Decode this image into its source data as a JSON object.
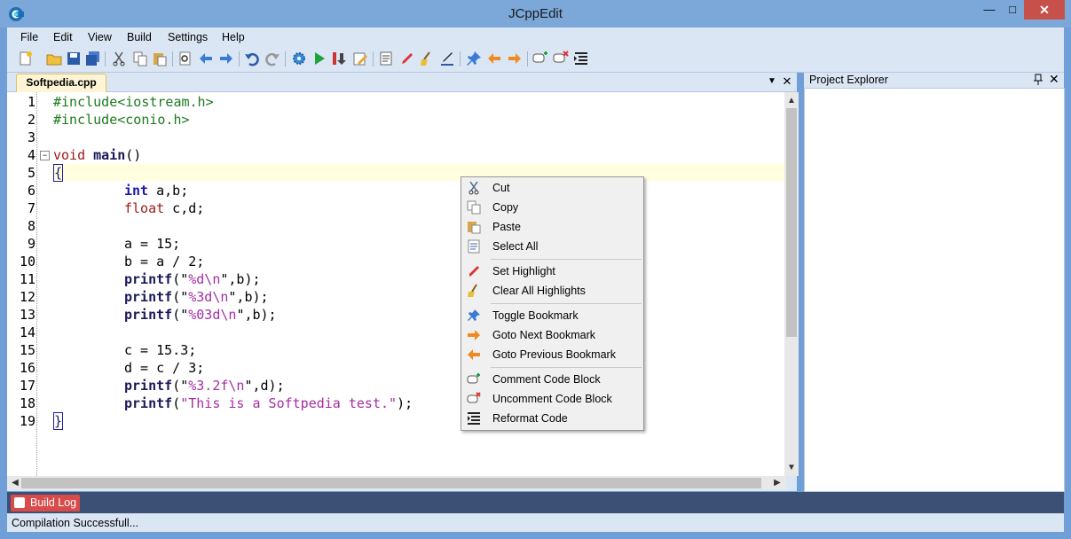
{
  "window": {
    "title": "JCppEdit",
    "min": "—",
    "max": "□",
    "close": "✕"
  },
  "menu": [
    "File",
    "Edit",
    "View",
    "Build",
    "Settings",
    "Help"
  ],
  "tab": {
    "label": "Softpedia.cpp",
    "dropdown": "▼",
    "close": "✕"
  },
  "line_numbers": [
    "1",
    "2",
    "3",
    "4",
    "5",
    "6",
    "7",
    "8",
    "9",
    "10",
    "11",
    "12",
    "13",
    "14",
    "15",
    "16",
    "17",
    "18",
    "19"
  ],
  "code": {
    "l1": "#include<iostream.h>",
    "l2": "#include<conio.h>",
    "l4_kw": "void",
    "l4_name": "main",
    "l4_rest": "()",
    "l5": "{",
    "l6_kw": "int",
    "l6_rest": " a,b;",
    "l7_kw": "float",
    "l7_rest": " c,d;",
    "l9": "a = 15;",
    "l10": "b = a / 2;",
    "l11_fn": "printf",
    "l11_open": "(\"",
    "l11_str": "%d\\n",
    "l11_close": "\",b);",
    "l12_fn": "printf",
    "l12_open": "(\"",
    "l12_str": "%3d\\n",
    "l12_close": "\",b);",
    "l13_fn": "printf",
    "l13_open": "(\"",
    "l13_str": "%03d\\n",
    "l13_close": "\",b);",
    "l15": "c = 15.3;",
    "l16": "d = c / 3;",
    "l17_fn": "printf",
    "l17_open": "(\"",
    "l17_str": "%3.2f\\n",
    "l17_close": "\",d);",
    "l18_fn": "printf",
    "l18_open": "(",
    "l18_str": "\"This is a Softpedia test.\"",
    "l18_close": ");",
    "l19": "}"
  },
  "fold_marker": "−",
  "project_explorer": {
    "title": "Project Explorer",
    "pin": "📌",
    "close": "✕"
  },
  "build_log": {
    "label": "Build Log"
  },
  "status": {
    "text": "Compilation Successfull..."
  },
  "context_menu": {
    "items": [
      {
        "label": "Cut",
        "icon": "scissors-icon"
      },
      {
        "label": "Copy",
        "icon": "copy-icon"
      },
      {
        "label": "Paste",
        "icon": "paste-icon"
      },
      {
        "label": "Select All",
        "icon": "select-all-icon"
      },
      {
        "label": "Set Highlight",
        "icon": "highlighter-icon"
      },
      {
        "label": "Clear All Highlights",
        "icon": "broom-icon"
      },
      {
        "label": "Toggle Bookmark",
        "icon": "pin-icon"
      },
      {
        "label": "Goto Next Bookmark",
        "icon": "arrow-right-icon"
      },
      {
        "label": "Goto Previous Bookmark",
        "icon": "arrow-left-icon"
      },
      {
        "label": "Comment Code Block",
        "icon": "comment-icon"
      },
      {
        "label": "Uncomment Code Block",
        "icon": "uncomment-icon"
      },
      {
        "label": "Reformat Code",
        "icon": "reformat-icon"
      }
    ]
  },
  "colors": {
    "accent": "#7ba7d9",
    "panel": "#dbe6f4",
    "keyword": "#a11a1a",
    "type": "#1a1aa8",
    "preproc": "#1e7a1e",
    "string": "#a42da4",
    "build_tab": "#d94b4b"
  }
}
